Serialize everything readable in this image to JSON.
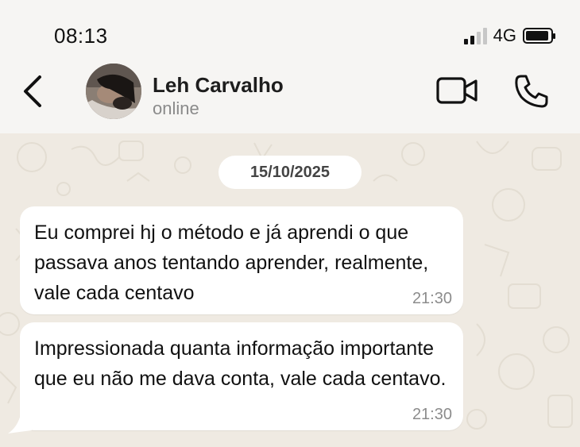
{
  "status_bar": {
    "time": "08:13",
    "network": "4G",
    "signal_icon": "signal-bars-icon",
    "battery_icon": "battery-icon"
  },
  "header": {
    "back_icon": "chevron-left-icon",
    "contact_name": "Leh Carvalho",
    "contact_status": "online",
    "video_icon": "video-camera-icon",
    "call_icon": "phone-icon"
  },
  "chat": {
    "date": "15/10/2025",
    "messages": [
      {
        "text": "Eu comprei hj o método e já aprendi o que passava anos tentando aprender, realmente, vale cada centavo",
        "time": "21:30"
      },
      {
        "text": "Impressionada quanta informação importante que eu não me dava conta, vale cada centavo.",
        "time": "21:30"
      }
    ]
  },
  "colors": {
    "header_bg": "#f6f5f3",
    "chat_bg": "#efeae2",
    "bubble_bg": "#ffffff",
    "timestamp": "#8c8c8c"
  }
}
